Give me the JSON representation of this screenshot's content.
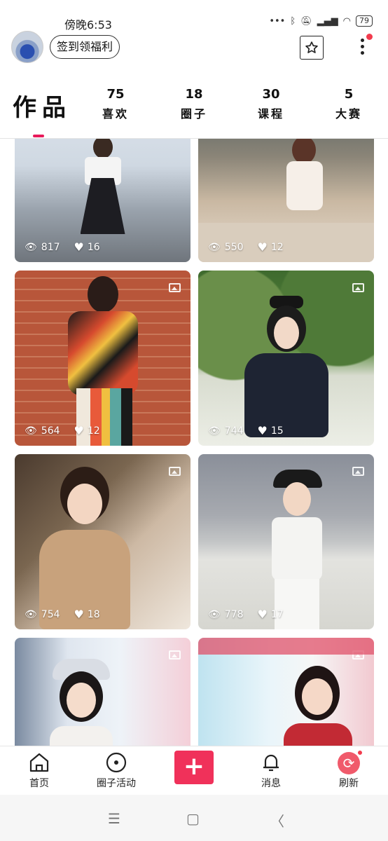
{
  "status_bar": {
    "time": "傍晚6:53",
    "battery": "79"
  },
  "header": {
    "signin_label": "签到领福利"
  },
  "tabs": {
    "main_label": "作品",
    "items": [
      {
        "count": "75",
        "label": "喜欢"
      },
      {
        "count": "18",
        "label": "圈子"
      },
      {
        "count": "30",
        "label": "课程"
      },
      {
        "count": "5",
        "label": "大赛"
      }
    ]
  },
  "posts": [
    {
      "views": "817",
      "likes": "16"
    },
    {
      "views": "550",
      "likes": "12"
    },
    {
      "views": "564",
      "likes": "12"
    },
    {
      "views": "744",
      "likes": "15"
    },
    {
      "views": "754",
      "likes": "18"
    },
    {
      "views": "778",
      "likes": "17"
    },
    {
      "views": "",
      "likes": ""
    },
    {
      "views": "",
      "likes": ""
    }
  ],
  "bottom_nav": {
    "home": "首页",
    "circle_activity": "圈子活动",
    "messages": "消息",
    "refresh": "刷新"
  },
  "colors": {
    "accent": "#f0315a",
    "badge": "#f23b4d"
  }
}
